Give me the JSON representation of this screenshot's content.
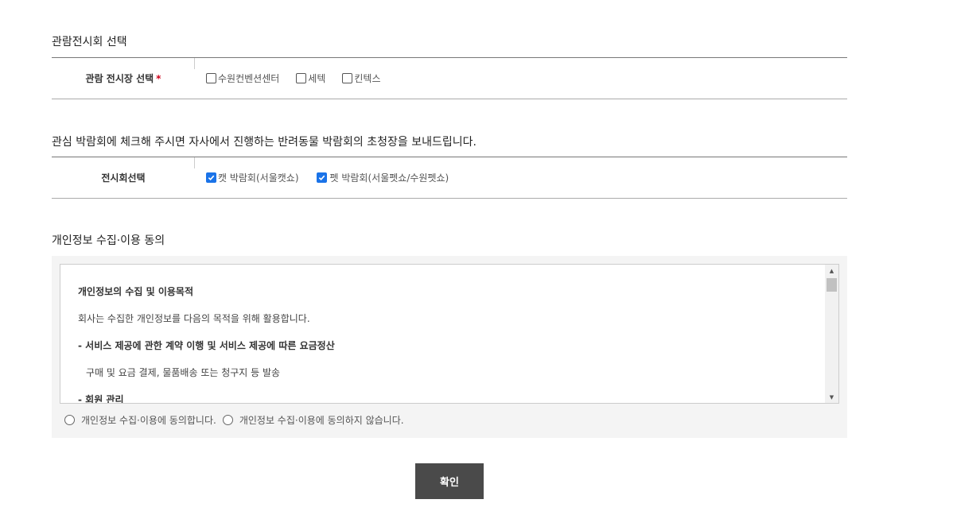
{
  "venue_section": {
    "title": "관람전시회 선택",
    "label": "관람 전시장 선택",
    "required_mark": "*",
    "options": [
      {
        "label": "수원컨벤션센터",
        "checked": false
      },
      {
        "label": "세텍",
        "checked": false
      },
      {
        "label": "킨텍스",
        "checked": false
      }
    ]
  },
  "interest_section": {
    "title": "관심 박람회에 체크해 주시면 자사에서 진행하는 반려동물 박람회의 초청장을 보내드립니다.",
    "label": "전시회선택",
    "options": [
      {
        "label": "캣 박람회(서울캣쇼)",
        "checked": true
      },
      {
        "label": "펫 박람회(서울펫쇼/수원펫쇼)",
        "checked": true
      }
    ]
  },
  "privacy_section": {
    "title": "개인정보 수집·이용 동의",
    "terms": [
      "개인정보의 수집 및 이용목적",
      "회사는 수집한 개인정보를 다음의 목적을 위해 활용합니다.",
      "- 서비스 제공에 관한 계약 이행 및 서비스 제공에 따른 요금정산",
      "구매 및 요금 결제, 물품배송 또는 청구지 등 발송",
      "- 회원 관리"
    ],
    "agree_label": "개인정보 수집·이용에 동의합니다.",
    "disagree_label": "개인정보 수집·이용에 동의하지 않습니다."
  },
  "confirm_label": "확인",
  "colors": {
    "checkbox_checked": "#1a73e8",
    "button_bg": "#4a4a4a",
    "required": "#d0021b"
  }
}
